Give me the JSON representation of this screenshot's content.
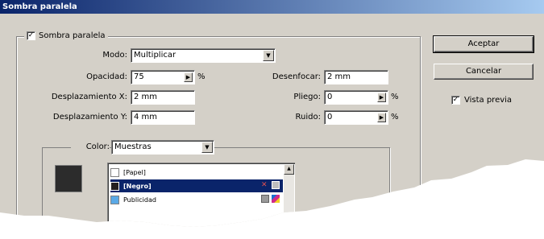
{
  "dialog": {
    "title": "Sombra paralela"
  },
  "shadow_group": {
    "check_mark": "✓",
    "label": "Sombra paralela"
  },
  "fields": {
    "modo_label": "Modo:",
    "modo_value": "Multiplicar",
    "opacidad_label": "Opacidad:",
    "opacidad_value": "75",
    "opacidad_unit": "%",
    "desp_x_label": "Desplazamiento X:",
    "desp_x_value": "2 mm",
    "desp_y_label": "Desplazamiento Y:",
    "desp_y_value": "4 mm",
    "desenfocar_label": "Desenfocar:",
    "desenfocar_value": "2 mm",
    "pliego_label": "Pliego:",
    "pliego_value": "0",
    "pliego_unit": "%",
    "ruido_label": "Ruido:",
    "ruido_value": "0",
    "ruido_unit": "%"
  },
  "color_group": {
    "label": "Color:",
    "value": "Muestras",
    "swatch_color": "#2c2c2c"
  },
  "swatches": [
    {
      "name": "[Papel]",
      "color": "#ffffff",
      "selected": false
    },
    {
      "name": "[Negro]",
      "color": "#231f20",
      "selected": true
    },
    {
      "name": "Publicidad",
      "color": "#5aa9e6",
      "selected": false
    }
  ],
  "buttons": {
    "ok": "Aceptar",
    "cancel": "Cancelar"
  },
  "preview": {
    "check_mark": "✓",
    "label": "Vista previa"
  }
}
